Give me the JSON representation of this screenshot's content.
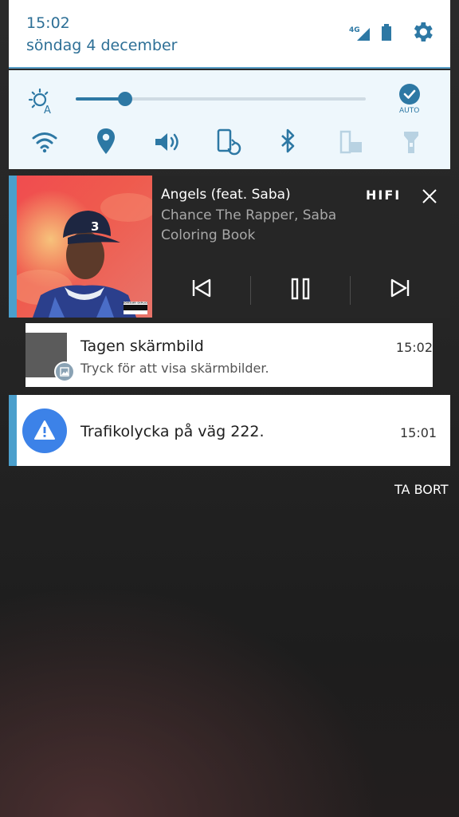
{
  "status_header": {
    "time": "15:02",
    "date": "söndag 4 december",
    "network_label": "4G",
    "icons": [
      "signal-icon",
      "battery-icon",
      "gear-icon"
    ]
  },
  "quick_settings": {
    "brightness_level": 0.17,
    "auto_label": "AUTO",
    "toggles": [
      "wifi-icon",
      "location-icon",
      "volume-icon",
      "rotate-icon",
      "bluetooth-icon",
      "multiwindow-icon",
      "flashlight-icon"
    ]
  },
  "media": {
    "title": "Angels (feat. Saba)",
    "artist": "Chance The Rapper, Saba",
    "album": "Coloring Book",
    "badge": "HIFI",
    "cover_hat_number": "3",
    "cover_advisory": "PARENTAL ADVISORY EXPLICIT CONTENT",
    "controls": [
      "previous-icon",
      "pause-icon",
      "next-icon"
    ]
  },
  "screenshot_notification": {
    "title": "Tagen skärmbild",
    "subtitle": "Tryck för att visa skärmbilder.",
    "time": "15:02"
  },
  "traffic_notification": {
    "title": "Trafikolycka på väg 222.",
    "time": "15:01"
  },
  "clear_all_label": "TA BORT",
  "colors": {
    "accent": "#4b9fcc",
    "header_text": "#2d6f96",
    "warning_icon_bg": "#3c82e8"
  }
}
